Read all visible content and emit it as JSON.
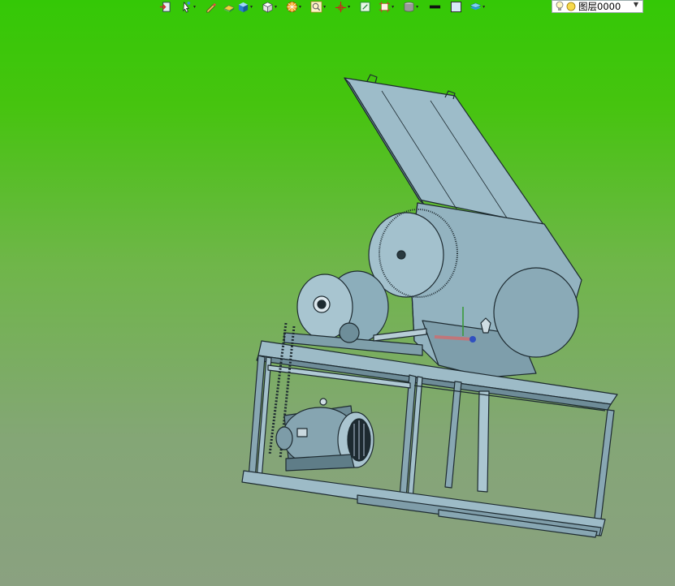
{
  "toolbar": {
    "items": [
      {
        "icon": "import-icon",
        "dropdown": false
      },
      {
        "icon": "pointer-icon",
        "dropdown": true
      },
      {
        "icon": "pen-icon",
        "dropdown": false
      },
      {
        "icon": "extrude-icon",
        "dropdown": false
      },
      {
        "icon": "box-solid-icon",
        "dropdown": true
      },
      {
        "icon": "view-cube-icon",
        "dropdown": true
      },
      {
        "icon": "render-sphere-icon",
        "dropdown": true
      },
      {
        "icon": "zoom-view-icon",
        "dropdown": true
      },
      {
        "icon": "axis-triad-icon",
        "dropdown": true
      },
      {
        "icon": "snap-grid-icon",
        "dropdown": false
      },
      {
        "icon": "frame-icon",
        "dropdown": true
      },
      {
        "icon": "cylinder-icon",
        "dropdown": true
      },
      {
        "icon": "line-style-icon",
        "dropdown": false
      },
      {
        "icon": "color-swatch-icon",
        "dropdown": false
      },
      {
        "icon": "layers-icon",
        "dropdown": true
      }
    ],
    "layer_selector": {
      "label": "图层0000"
    }
  },
  "colors": {
    "background_top": "#34c806",
    "background_bottom": "#8aa180",
    "model_fill": "#8fafbd",
    "model_edge": "#1d2a30"
  }
}
